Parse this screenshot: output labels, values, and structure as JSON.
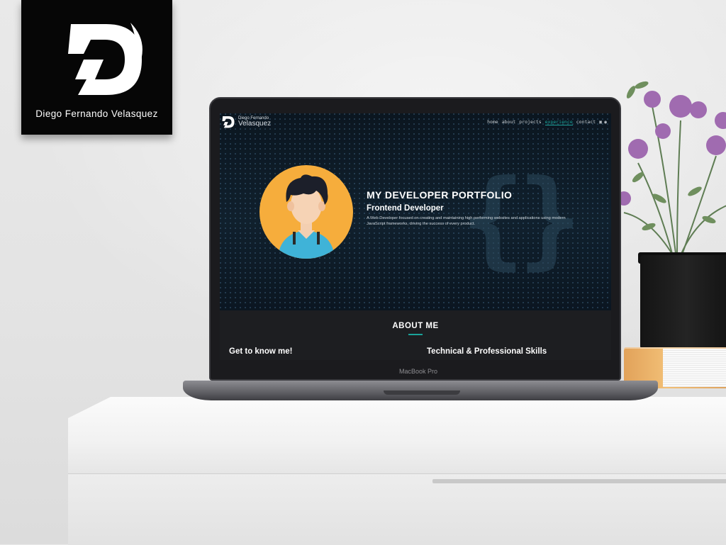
{
  "brand": {
    "logo_caption": "Diego Fernando Velasquez"
  },
  "laptop": {
    "model_label": "MacBook Pro"
  },
  "site": {
    "logo": {
      "line1": "Diego Fernando",
      "line2": "Velasquez"
    },
    "nav": [
      {
        "label": "home",
        "active": false
      },
      {
        "label": "about",
        "active": false
      },
      {
        "label": "projects",
        "active": false
      },
      {
        "label": "experience",
        "active": true
      },
      {
        "label": "contact",
        "active": false
      }
    ],
    "nav_icons": [
      "linkedin-icon",
      "github-icon"
    ],
    "hero": {
      "title": "MY DEVELOPER PORTFOLIO",
      "subtitle": "Frontend Developer",
      "description": "A Web Developer focused on creating and maintaining high performing websites and applications using modern JavaScript frameworks, driving the success of every product."
    },
    "about": {
      "title": "ABOUT ME",
      "left_heading": "Get to know me!",
      "right_heading": "Technical & Professional Skills"
    }
  },
  "colors": {
    "accent": "#1aa39a",
    "hero_bg": "#0d1823",
    "about_bg": "#1d1e21",
    "avatar_bg": "#f6ad3c"
  }
}
